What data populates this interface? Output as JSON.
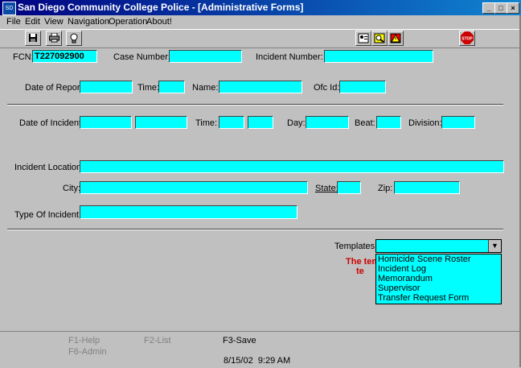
{
  "window": {
    "title": "San Diego Community College Police - [Administrative Forms]",
    "app_icon_text": "SD",
    "controls": {
      "minimize": "_",
      "maximize": "□",
      "close": "×"
    }
  },
  "menu": [
    "File",
    "Edit",
    "View",
    "Navigation",
    "Operation",
    "About!"
  ],
  "toolbar": {
    "icons": [
      "save-icon",
      "print-icon",
      "lightbulb-icon",
      "user-lookup-icon",
      "search-records-icon",
      "alert-icon",
      "stop-icon"
    ],
    "stop_label": "STOP"
  },
  "form": {
    "fcn_label": "FCN:",
    "fcn_value": "T227092900",
    "case_number_label": "Case Number:",
    "incident_number_label": "Incident Number:",
    "date_of_report_label": "Date of Report:",
    "time_label": "Time:",
    "name_label": "Name:",
    "ofc_id_label": "Ofc Id:",
    "date_of_incident_label": "Date of Incident:",
    "time2_label": "Time:",
    "day_label": "Day:",
    "beat_label": "Beat:",
    "division_label": "Division:",
    "incident_location_label": "Incident Location:",
    "city_label": "City:",
    "state_label": "State:",
    "zip_label": "Zip:",
    "type_of_incident_label": "Type Of Incident:",
    "templates_label": "Templates:",
    "warning_line1": "The tem",
    "warning_line2": "te"
  },
  "templates": {
    "selected": "",
    "options": [
      "Homicide Scene Roster",
      "Incident Log",
      "Memorandum",
      "Supervisor",
      "Transfer Request Form"
    ]
  },
  "status": {
    "f1": "F1-Help",
    "f2": "F2-List",
    "f3": "F3-Save",
    "f6": "F6-Admin",
    "datetime": "8/15/02  9:29 AM"
  }
}
